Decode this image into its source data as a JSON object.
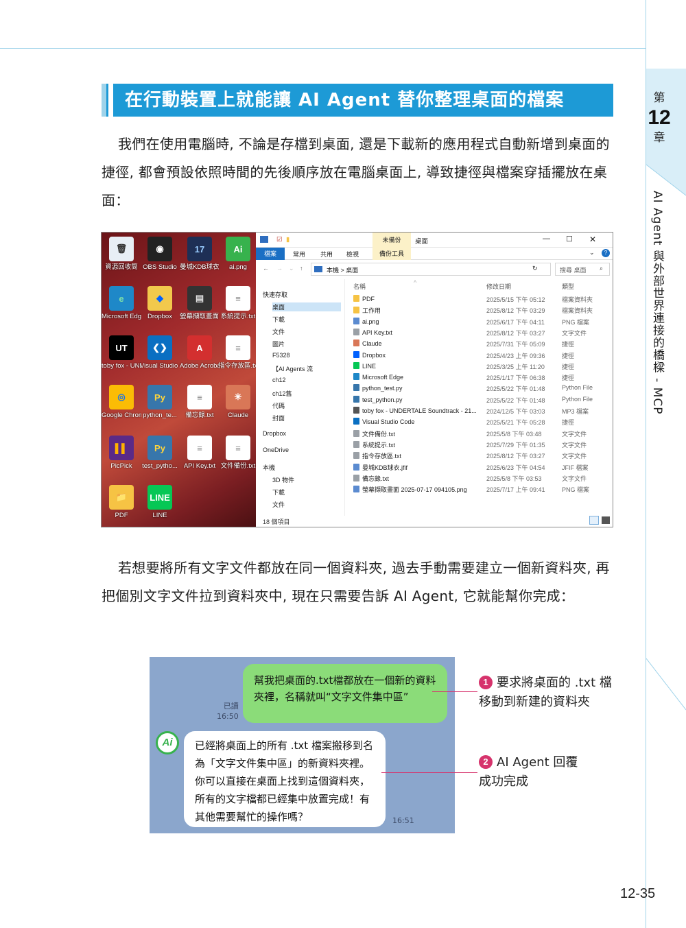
{
  "chapter": {
    "prefix": "第",
    "number": "12",
    "suffix": "章",
    "title": "AI Agent 與外部世界連接的橋樑 - MCP"
  },
  "section_heading": "在行動裝置上就能讓 AI Agent 替你整理桌面的檔案",
  "paragraph1": "我們在使用電腦時, 不論是存檔到桌面, 還是下載新的應用程式自動新增到桌面的捷徑, 都會預設依照時間的先後順序放在電腦桌面上, 導致捷徑與檔案穿插擺放在桌面：",
  "paragraph2": "若想要將所有文字文件都放在同一個資料夾, 過去手動需要建立一個新資料夾, 再把個別文字文件拉到資料夾中, 現在只需要告訴 AI Agent, 它就能幫你完成：",
  "desktop_icons": [
    {
      "label": "資源回收筒",
      "glyph": "🗑",
      "bg": "#e8eef5",
      "fg": "#333"
    },
    {
      "label": "OBS Studio",
      "glyph": "◉",
      "bg": "#222",
      "fg": "#fff"
    },
    {
      "label": "曼城KDB球衣.jfif",
      "glyph": "17",
      "bg": "#1e2f55",
      "fg": "#9cf"
    },
    {
      "label": "ai.png",
      "glyph": "Ai",
      "bg": "#37b24d",
      "fg": "#fff"
    },
    {
      "label": "Microsoft Edge",
      "glyph": "e",
      "bg": "#1e88c8",
      "fg": "#7ee0a8"
    },
    {
      "label": "Dropbox",
      "glyph": "◆",
      "bg": "#f2c94c",
      "fg": "#0061fe"
    },
    {
      "label": "螢幕擷取畫面 2025-07-1...",
      "glyph": "▤",
      "bg": "#333",
      "fg": "#ddd"
    },
    {
      "label": "系統提示.txt",
      "glyph": "≡",
      "bg": "#fff",
      "fg": "#888"
    },
    {
      "label": "toby fox - UNDERTAL...",
      "glyph": "UT",
      "bg": "#000",
      "fg": "#fff"
    },
    {
      "label": "Visual Studio Code",
      "glyph": "❮❯",
      "bg": "#0a6fc2",
      "fg": "#fff"
    },
    {
      "label": "Adobe Acrobat",
      "glyph": "A",
      "bg": "#d32f2f",
      "fg": "#fff"
    },
    {
      "label": "指令存放區.txt",
      "glyph": "≡",
      "bg": "#fff",
      "fg": "#888"
    },
    {
      "label": "Google Chrome",
      "glyph": "◎",
      "bg": "#fbbc05",
      "fg": "#1a73e8"
    },
    {
      "label": "python_te...",
      "glyph": "Py",
      "bg": "#3776ab",
      "fg": "#ffd43b"
    },
    {
      "label": "備忘錄.txt",
      "glyph": "≡",
      "bg": "#fff",
      "fg": "#888"
    },
    {
      "label": "Claude",
      "glyph": "✳",
      "bg": "#d97757",
      "fg": "#fff"
    },
    {
      "label": "PicPick",
      "glyph": "▌▌",
      "bg": "#5b2a86",
      "fg": "#ffb300"
    },
    {
      "label": "test_pytho...",
      "glyph": "Py",
      "bg": "#3776ab",
      "fg": "#ffd43b"
    },
    {
      "label": "API Key.txt",
      "glyph": "≡",
      "bg": "#fff",
      "fg": "#888"
    },
    {
      "label": "文件備份.txt",
      "glyph": "≡",
      "bg": "#fff",
      "fg": "#888"
    },
    {
      "label": "PDF",
      "glyph": "📁",
      "bg": "#f6c344",
      "fg": "#c0392b"
    },
    {
      "label": "LINE",
      "glyph": "LINE",
      "bg": "#06c755",
      "fg": "#fff"
    }
  ],
  "explorer": {
    "title_tab": "未備份",
    "title_tab2": "桌面",
    "ribbon_tabs": [
      "檔案",
      "常用",
      "共用",
      "檢視",
      "備份工具"
    ],
    "breadcrumb": "本機 > 桌面",
    "search_placeholder": "搜尋 桌面",
    "col_name": "名稱",
    "col_date": "修改日期",
    "col_type": "類型",
    "nav_items": [
      "快速存取",
      "桌面",
      "下載",
      "文件",
      "圖片",
      "F5328",
      "【AI Agents 流",
      "ch12",
      "ch12舊",
      "代碼",
      "封面",
      "Dropbox",
      "OneDrive",
      "本機",
      "3D 物件",
      "下載",
      "文件"
    ],
    "files": [
      {
        "name": "PDF",
        "date": "2025/5/15 下午 05:12",
        "type": "檔案資料夾",
        "color": "#f6c344"
      },
      {
        "name": "工作用",
        "date": "2025/8/12 下午 03:29",
        "type": "檔案資料夾",
        "color": "#f6c344"
      },
      {
        "name": "ai.png",
        "date": "2025/6/17 下午 04:11",
        "type": "PNG 檔案",
        "color": "#5b8bd0"
      },
      {
        "name": "API Key.txt",
        "date": "2025/8/12 下午 03:27",
        "type": "文字文件",
        "color": "#9aa0a6"
      },
      {
        "name": "Claude",
        "date": "2025/7/31 下午 05:09",
        "type": "捷徑",
        "color": "#d97757"
      },
      {
        "name": "Dropbox",
        "date": "2025/4/23 上午 09:36",
        "type": "捷徑",
        "color": "#0061fe"
      },
      {
        "name": "LINE",
        "date": "2025/3/25 上午 11:20",
        "type": "捷徑",
        "color": "#06c755"
      },
      {
        "name": "Microsoft Edge",
        "date": "2025/1/17 下午 06:38",
        "type": "捷徑",
        "color": "#1e88c8"
      },
      {
        "name": "python_test.py",
        "date": "2025/5/22 下午 01:48",
        "type": "Python File",
        "color": "#3776ab"
      },
      {
        "name": "test_python.py",
        "date": "2025/5/22 下午 01:48",
        "type": "Python File",
        "color": "#3776ab"
      },
      {
        "name": "toby fox - UNDERTALE Soundtrack - 21...",
        "date": "2024/12/5 下午 03:03",
        "type": "MP3 檔案",
        "color": "#555"
      },
      {
        "name": "Visual Studio Code",
        "date": "2025/5/21 下午 05:28",
        "type": "捷徑",
        "color": "#0a6fc2"
      },
      {
        "name": "文件備份.txt",
        "date": "2025/5/8 下午 03:48",
        "type": "文字文件",
        "color": "#9aa0a6"
      },
      {
        "name": "系統提示.txt",
        "date": "2025/7/29 下午 01:35",
        "type": "文字文件",
        "color": "#9aa0a6"
      },
      {
        "name": "指令存放區.txt",
        "date": "2025/8/12 下午 03:27",
        "type": "文字文件",
        "color": "#9aa0a6"
      },
      {
        "name": "曼城KDB球衣.jfif",
        "date": "2025/6/23 下午 04:54",
        "type": "JFIF 檔案",
        "color": "#5b8bd0"
      },
      {
        "name": "備忘錄.txt",
        "date": "2025/5/8 下午 03:53",
        "type": "文字文件",
        "color": "#9aa0a6"
      },
      {
        "name": "螢幕擷取畫面 2025-07-17 094105.png",
        "date": "2025/7/17 上午 09:41",
        "type": "PNG 檔案",
        "color": "#5b8bd0"
      }
    ],
    "status": "18 個項目"
  },
  "chat": {
    "user_message": "幫我把桌面的.txt檔都放在一個新的資料夾裡，名稱就叫“文字文件集中區”",
    "read_label": "已讀",
    "user_time": "16:50",
    "avatar_label": "Ai",
    "agent_message": "已經將桌面上的所有 .txt 檔案搬移到名為「文字文件集中區」的新資料夾裡。你可以直接在桌面上找到這個資料夾，所有的文字檔都已經集中放置完成！有其他需要幫忙的操作嗎？",
    "agent_time": "16:51"
  },
  "callouts": [
    {
      "number": "1",
      "text_line1": "要求將桌面的 .txt 檔",
      "text_line2": "移動到新建的資料夾"
    },
    {
      "number": "2",
      "text_line1": "AI Agent 回覆",
      "text_line2": "成功完成"
    }
  ],
  "page_number": "12-35",
  "colors": {
    "accent": "#1d9ad6",
    "accent_light": "#9fd3ea",
    "callout": "#d6336c",
    "chat_bg": "#8ba6cc",
    "bubble_out": "#8bdc79"
  }
}
